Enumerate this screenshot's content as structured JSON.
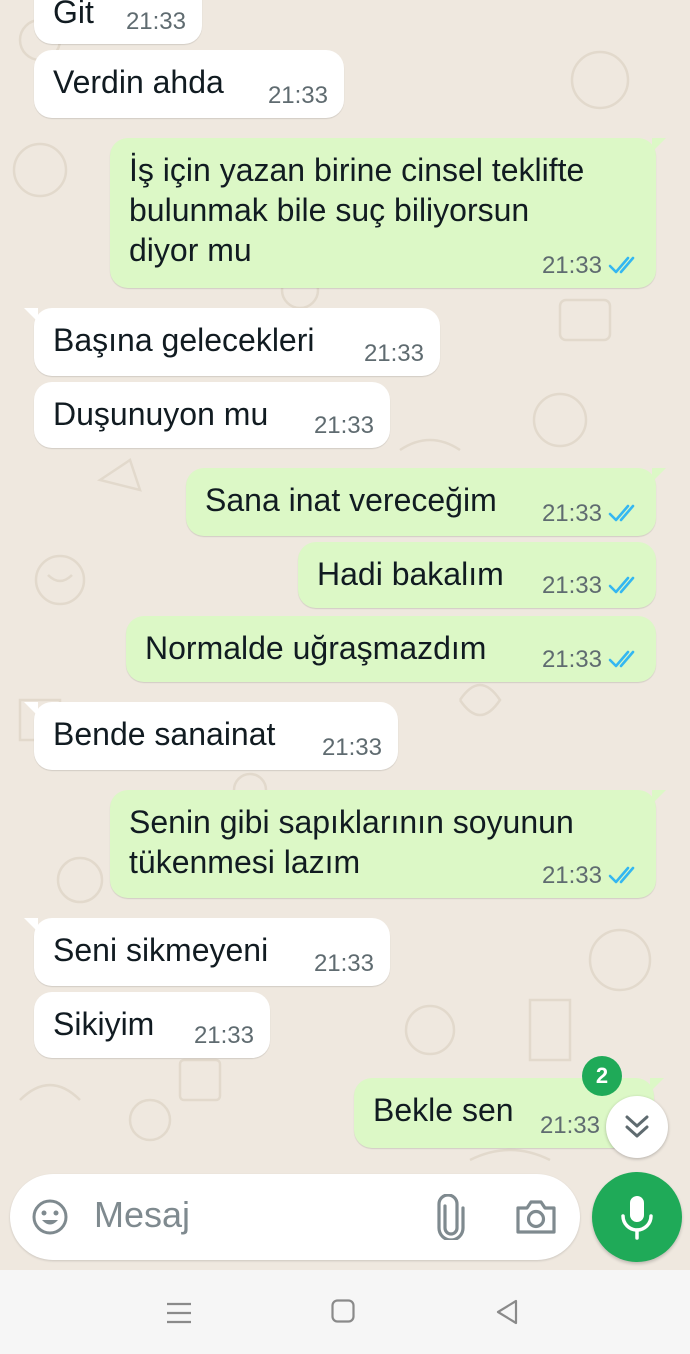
{
  "chat": {
    "messages": [
      {
        "dir": "in",
        "text": "Git",
        "time": "21:33"
      },
      {
        "dir": "in",
        "text": "Verdin ahda",
        "time": "21:33"
      },
      {
        "dir": "out",
        "lines": [
          "İş için yazan birine cinsel teklifte",
          "bulunmak bile suç biliyorsun",
          "diyor mu"
        ],
        "time": "21:33",
        "status": "read"
      },
      {
        "dir": "in",
        "text": "Başına gelecekleri",
        "time": "21:33"
      },
      {
        "dir": "in",
        "text": "Duşunuyon mu",
        "time": "21:33"
      },
      {
        "dir": "out",
        "text": "Sana inat vereceğim",
        "time": "21:33",
        "status": "read"
      },
      {
        "dir": "out",
        "text": "Hadi bakalım",
        "time": "21:33",
        "status": "read"
      },
      {
        "dir": "out",
        "text": "Normalde uğraşmazdım",
        "time": "21:33",
        "status": "read"
      },
      {
        "dir": "in",
        "text": "Bende sanainat",
        "time": "21:33"
      },
      {
        "dir": "out",
        "lines": [
          "Senin gibi sapıklarının soyunun",
          "tükenmesi lazım"
        ],
        "time": "21:33",
        "status": "read"
      },
      {
        "dir": "in",
        "text": "Seni sikmeyeni",
        "time": "21:33"
      },
      {
        "dir": "in",
        "text": "Sikiyim",
        "time": "21:33"
      },
      {
        "dir": "out",
        "text": "Bekle sen",
        "time": "21:33",
        "status": "read"
      }
    ],
    "unread_count": "2"
  },
  "composer": {
    "placeholder": "Mesaj",
    "emoji_icon": "emoji-icon",
    "attach_icon": "paperclip-icon",
    "camera_icon": "camera-icon",
    "mic_icon": "microphone-icon"
  },
  "nav": {
    "recents_icon": "menu-lines-icon",
    "home_icon": "square-home-icon",
    "back_icon": "triangle-back-icon"
  },
  "colors": {
    "wallpaper": "#efe8df",
    "incoming_bubble": "#ffffff",
    "outgoing_bubble": "#dcf8c6",
    "read_ticks": "#34b7f1",
    "accent_green": "#1faa58"
  }
}
